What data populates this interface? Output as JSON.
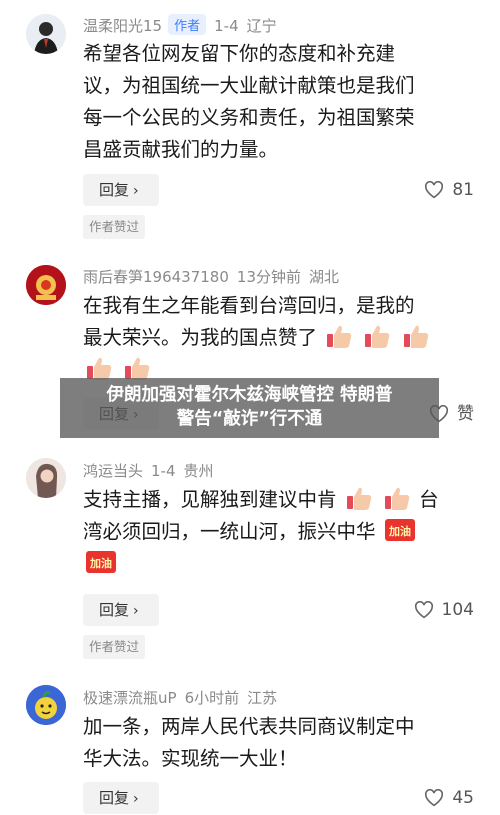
{
  "comments": [
    {
      "username": "温柔阳光15",
      "author_tag": "作者",
      "date": "1-4",
      "location": "辽宁",
      "text_lines": [
        "希望各位网友留下你的态度和补充建",
        "议，为祖国统一大业献计献策也是我们",
        "每一个公民的义务和责任，为祖国繁荣",
        "昌盛贡献我们的力量。"
      ],
      "reply_label": "回复",
      "likes": "81",
      "liked_tag": "作者赞过"
    },
    {
      "username": "雨后春笋196437180",
      "date": "13分钟前",
      "location": "湖北",
      "text_line1": "在我有生之年能看到台湾回归，是我的",
      "text_line2": "最大荣兴。为我的国点赞了",
      "reply_label": "回复",
      "likes": "赞",
      "emoji_names": [
        "thumbs-up-emoji",
        "thumbs-up-emoji",
        "thumbs-up-emoji",
        "thumbs-up-emoji",
        "thumbs-up-emoji"
      ]
    },
    {
      "username": "鸿运当头",
      "date": "1-4",
      "location": "贵州",
      "text_line1_a": "支持主播，见解独到建议中肯",
      "text_line1_b": "台",
      "text_line2": "湾必须回归，一统山河，振兴中华",
      "reply_label": "回复",
      "likes": "104",
      "liked_tag": "作者赞过",
      "emoji_names": [
        "thumbs-up-emoji",
        "thumbs-up-emoji",
        "jiayou-sticker",
        "jiayou-sticker"
      ],
      "sticker_text": "加油"
    },
    {
      "username": "极速漂流瓶uP",
      "date": "6小时前",
      "location": "江苏",
      "text_lines": [
        "加一条，两岸人民代表共同商议制定中",
        "华大法。实现统一大业！"
      ],
      "reply_label": "回复",
      "likes": "45"
    }
  ],
  "overlay": {
    "line1": "伊朗加强对霍尔木兹海峡管控 特朗普",
    "line2": "警告“敲诈”行不通"
  },
  "colors": {
    "meta": "#8a8a8a",
    "author_tag_bg": "#e8f0ff",
    "author_tag_text": "#3d7eff",
    "button_bg": "#f2f2f2"
  }
}
